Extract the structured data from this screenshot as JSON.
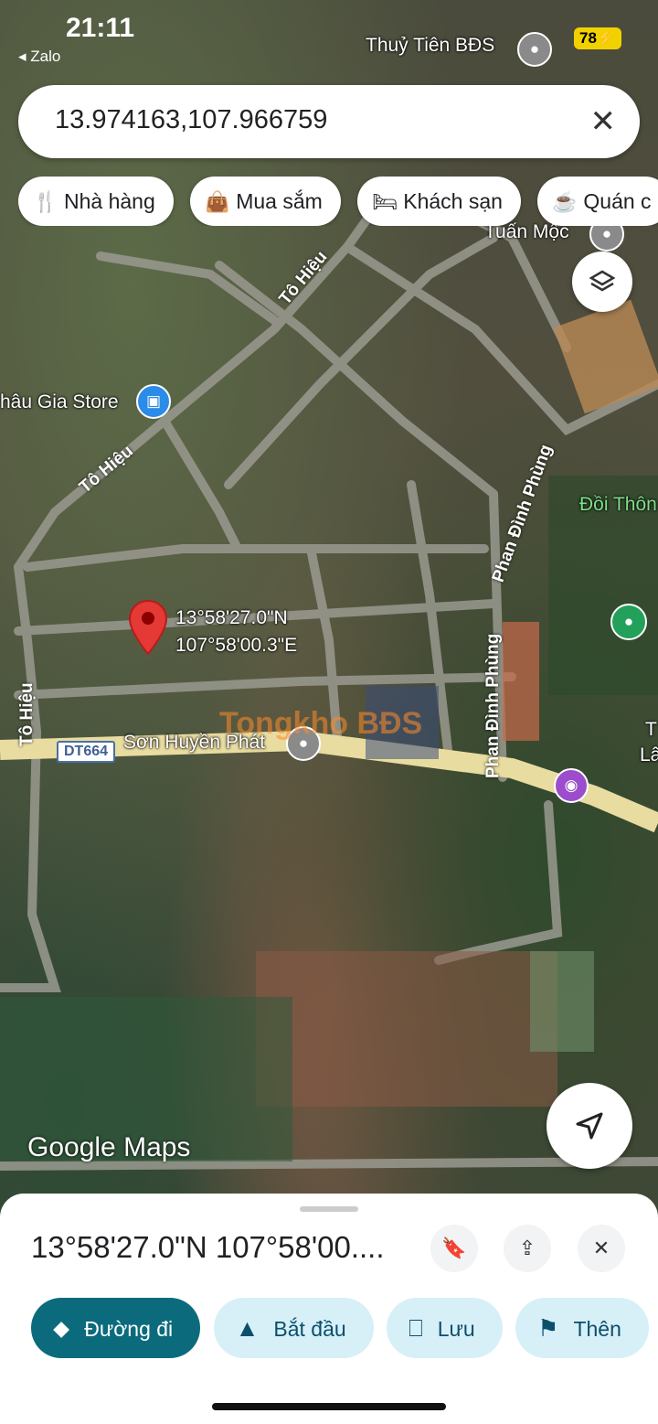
{
  "status": {
    "time": "21:11",
    "back_app": "Zalo",
    "battery": "78"
  },
  "search": {
    "query": "13.974163,107.966759",
    "clear_icon": "close-icon"
  },
  "chips": [
    {
      "label": "Nhà hàng",
      "icon": "restaurant-icon"
    },
    {
      "label": "Mua sắm",
      "icon": "shopping-bag-icon"
    },
    {
      "label": "Khách sạn",
      "icon": "hotel-icon"
    },
    {
      "label": "Quán c",
      "icon": "cafe-icon"
    }
  ],
  "map": {
    "labels": {
      "thuy_tien": "Thuỷ Tiên BĐS",
      "tuan_moc": "Tuấn Mộc",
      "chau_gia": "hâu Gia Store",
      "doi_thong": "Đồi Thôn",
      "son_huyen": "Sơn Huyền Phát",
      "t_lam": "T",
      "lam": "Lâ"
    },
    "roads": {
      "to_hieu_1": "Tô Hiệu",
      "to_hieu_2": "Tô Hiệu",
      "to_hieu_3": "Tô Hiệu",
      "phan_dinh_phung_1": "Phan Đình Phùng",
      "phan_dinh_phung_2": "Phan Đình Phùng",
      "phan_dinh_phung_3": "Phan Đình Phùng",
      "route": "DT664"
    },
    "pin": {
      "lat": "13°58'27.0\"N",
      "lng": "107°58'00.3\"E"
    },
    "watermark": "Tongkho BĐS",
    "attribution": "Google Maps"
  },
  "sheet": {
    "coords": "13°58'27.0\"N 107°58'00....",
    "actions": [
      {
        "label": "Đường đi",
        "icon": "directions-icon"
      },
      {
        "label": "Bắt đầu",
        "icon": "navigation-arrow-icon"
      },
      {
        "label": "Lưu",
        "icon": "bookmark-icon"
      },
      {
        "label": "Thên",
        "icon": "flag-icon"
      }
    ]
  },
  "colors": {
    "accent": "#0b6b7d",
    "pill": "#d7f0f7",
    "pin": "#e53935"
  }
}
